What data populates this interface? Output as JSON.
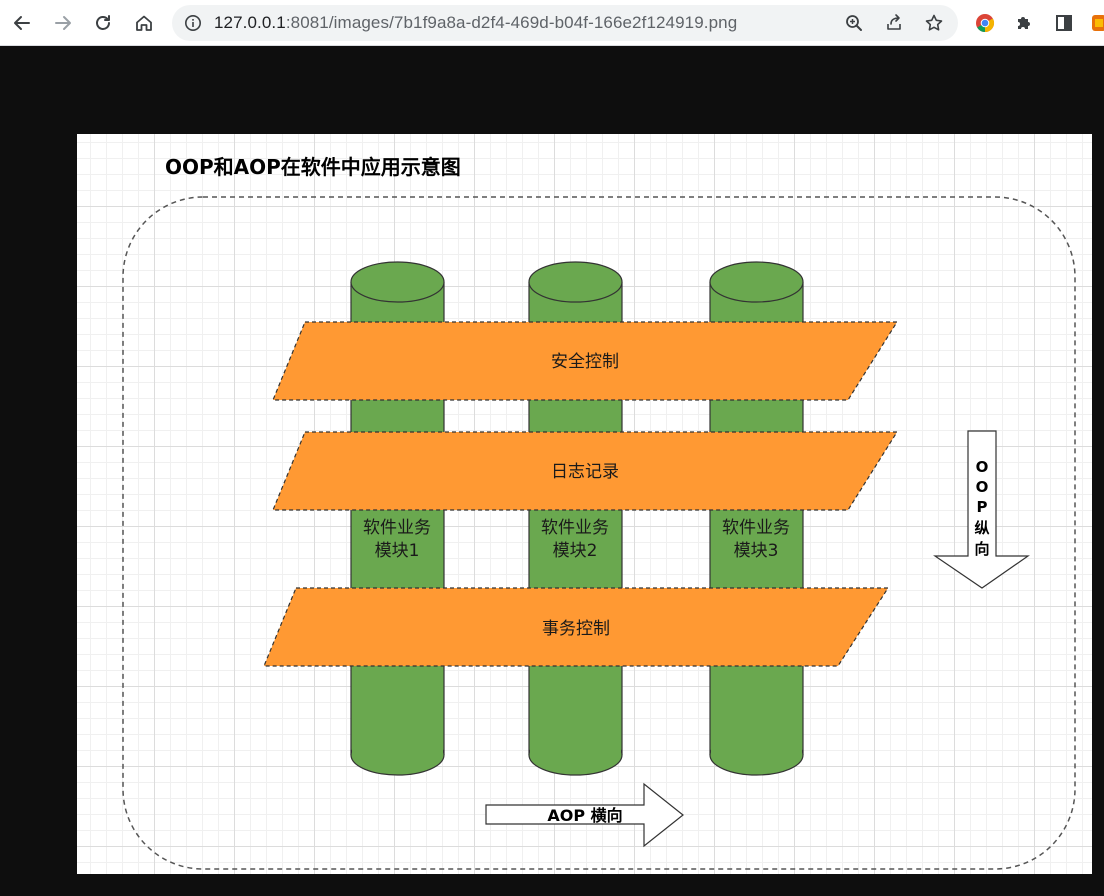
{
  "browser": {
    "url_host": "127.0.0.1",
    "url_rest": ":8081/images/7b1f9a8a-d2f4-469d-b04f-166e2f124919.png"
  },
  "diagram": {
    "title": "OOP和AOP在软件中应用示意图",
    "layers": {
      "security": "安全控制",
      "logging": "日志记录",
      "transaction": "事务控制"
    },
    "modules": {
      "m1_line1": "软件业务",
      "m1_line2": "模块1",
      "m2_line1": "软件业务",
      "m2_line2": "模块2",
      "m3_line1": "软件业务",
      "m3_line2": "模块3"
    },
    "oop_arrow": {
      "c1": "O",
      "c2": "O",
      "c3": "P",
      "c4": "纵",
      "c5": "向"
    },
    "aop_arrow_label": "AOP 横向",
    "colors": {
      "cylinder": "#6aa84f",
      "layer": "#ff9933",
      "dashed": "#555555"
    }
  }
}
